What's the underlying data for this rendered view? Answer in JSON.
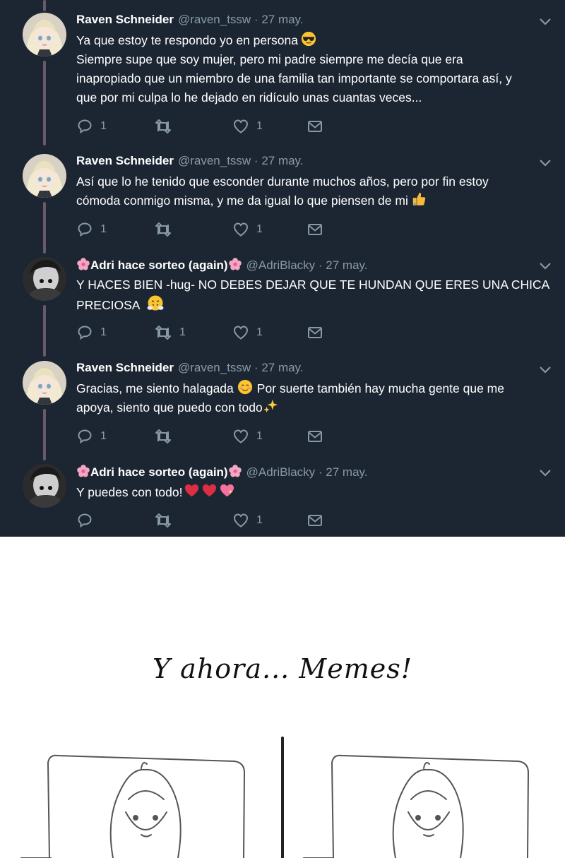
{
  "colors": {
    "background": "#1c2633",
    "text": "#ffffff",
    "secondary": "#8899a6",
    "thread_line": "#6b5868"
  },
  "tweets": [
    {
      "name": "Raven Schneider",
      "handle": "@raven_tssw",
      "date": "27 may.",
      "lines": [
        "Ya que estoy te respondo yo en persona",
        "Siempre supe que soy mujer, pero mi padre siempre me decía que era",
        "inapropiado que un miembro de una familia tan importante se comportara así, y",
        "que por mi culpa lo he dejado en ridículo unas cuantas veces..."
      ],
      "emoji": "smiling-face-with-sunglasses",
      "replies": "1",
      "retweets": "",
      "likes": "1"
    },
    {
      "name": "Raven Schneider",
      "handle": "@raven_tssw",
      "date": "27 may.",
      "lines": [
        "Así que lo he tenido que esconder durante muchos años, pero por fin estoy",
        "cómoda conmigo misma, y me da igual lo que piensen de mi"
      ],
      "emoji": "thumbs-up",
      "replies": "1",
      "retweets": "",
      "likes": "1"
    },
    {
      "name": "Adri hace sorteo (again)",
      "handle": "@AdriBlacky",
      "date": "27 may.",
      "lines": [
        "Y HACES BIEN -hug- NO DEBES DEJAR QUE TE HUNDAN QUE ERES UNA CHICA",
        "PRECIOSA"
      ],
      "emoji": "face-with-steam",
      "replies": "1",
      "retweets": "1",
      "likes": "1"
    },
    {
      "name": "Raven Schneider",
      "handle": "@raven_tssw",
      "date": "27 may.",
      "lines": [
        "Gracias, me siento halagada",
        "Por suerte también hay mucha gente que me",
        "apoya, siento que puedo con todo"
      ],
      "emoji": "smiling-face-and-sparkles",
      "replies": "1",
      "retweets": "",
      "likes": "1"
    },
    {
      "name": "Adri hace sorteo (again)",
      "handle": "@AdriBlacky",
      "date": "27 may.",
      "lines": [
        "Y puedes con todo!"
      ],
      "emoji": "hearts",
      "replies": "",
      "retweets": "",
      "likes": "1"
    }
  ],
  "meme_title": "Y ahora... Memes!"
}
